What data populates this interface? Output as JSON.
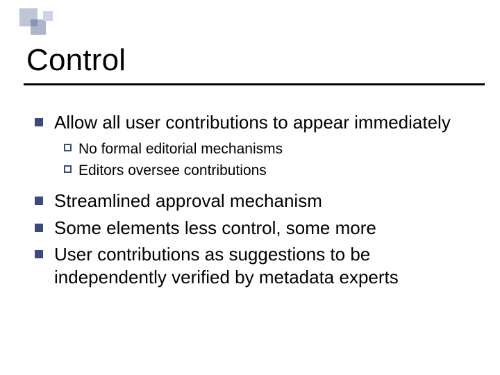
{
  "title": "Control",
  "bullets": {
    "b0": "Allow all user contributions to appear immediately",
    "b0_sub": {
      "s0": "No formal editorial mechanisms",
      "s1": "Editors oversee contributions"
    },
    "b1": "Streamlined approval mechanism",
    "b2": "Some elements less control, some more",
    "b3": "User contributions as suggestions to be independently verified by metadata experts"
  }
}
